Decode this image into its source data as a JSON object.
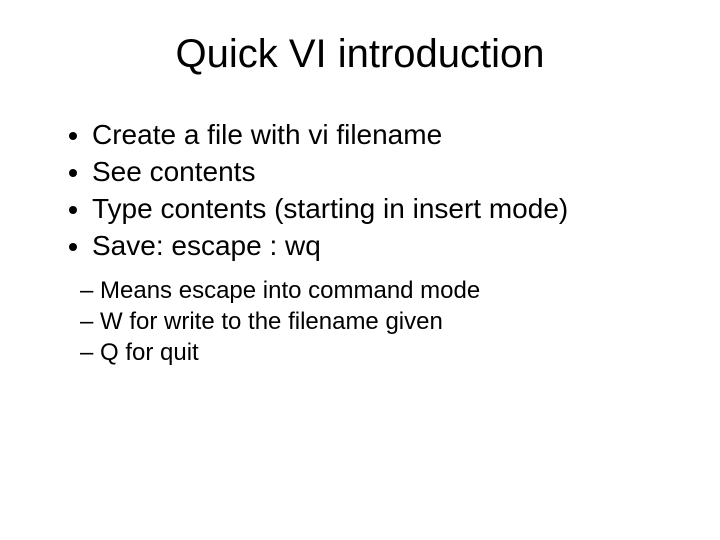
{
  "title": "Quick VI introduction",
  "bullets": [
    "Create a file with vi filename",
    "See contents",
    "Type contents (starting in insert mode)",
    "Save: escape : wq"
  ],
  "subbullets": [
    "Means escape into command mode",
    "W for write to the filename given",
    "Q for quit"
  ]
}
